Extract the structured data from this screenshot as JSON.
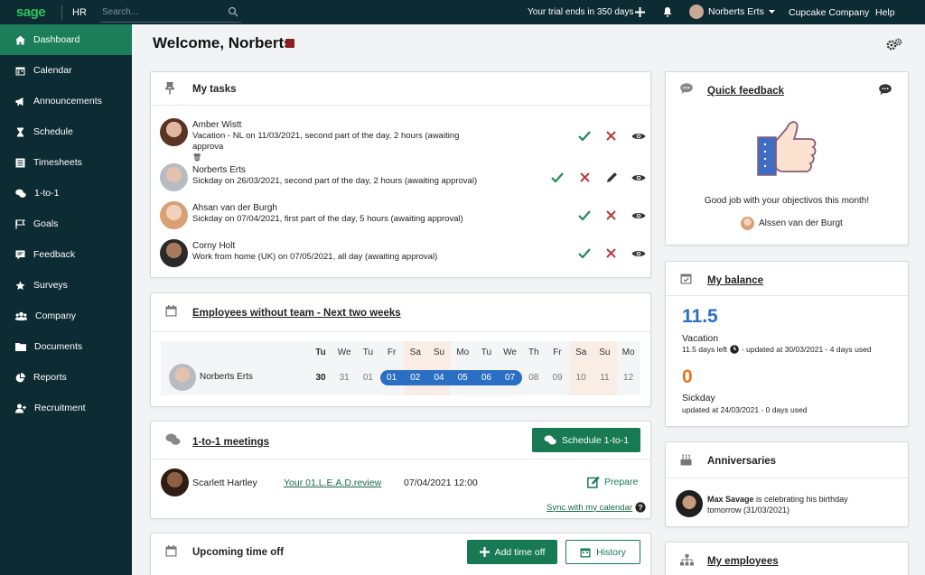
{
  "topbar": {
    "logo": "sage",
    "module": "HR",
    "search_placeholder": "Search...",
    "trial": "Your trial ends in 350 days",
    "user": "Norberts Erts",
    "company": "Cupcake Company",
    "help": "Help"
  },
  "sidebar": {
    "items": [
      {
        "label": "Dashboard",
        "icon": "home-icon",
        "active": true
      },
      {
        "label": "Calendar",
        "icon": "calendar-icon"
      },
      {
        "label": "Announcements",
        "icon": "megaphone-icon"
      },
      {
        "label": "Schedule",
        "icon": "hourglass-icon"
      },
      {
        "label": "Timesheets",
        "icon": "timesheet-icon"
      },
      {
        "label": "1-to-1",
        "icon": "chat-icon"
      },
      {
        "label": "Goals",
        "icon": "flag-icon"
      },
      {
        "label": "Feedback",
        "icon": "feedback-icon"
      },
      {
        "label": "Surveys",
        "icon": "star-icon"
      },
      {
        "label": "Company",
        "icon": "people-icon"
      },
      {
        "label": "Documents",
        "icon": "folder-icon"
      },
      {
        "label": "Reports",
        "icon": "pie-icon"
      },
      {
        "label": "Recruitment",
        "icon": "add-user-icon"
      }
    ]
  },
  "page": {
    "title": "Welcome, Norberts"
  },
  "tasks": {
    "title": "My tasks",
    "items": [
      {
        "name": "Amber Wistt",
        "desc": "Vacation - NL on 11/03/2021, second part of the day, 2 hours (awaiting approva",
        "extra": "🗑",
        "edit": false
      },
      {
        "name": "Norberts Erts",
        "desc": "Sickday on 26/03/2021, second part of the day, 2 hours (awaiting approval)",
        "edit": true
      },
      {
        "name": "Ahsan van der Burgh",
        "desc": "Sickday on 07/04/2021, first part of the day, 5 hours (awaiting approval)",
        "edit": false
      },
      {
        "name": "Corny Holt",
        "desc": "Work from home (UK) on 07/05/2021, all day (awaiting approval)",
        "edit": false
      }
    ]
  },
  "noteam": {
    "title": "Employees without team - Next two weeks",
    "employee": "Norberts Erts",
    "days": [
      "Tu",
      "We",
      "Tu",
      "Fr",
      "Sa",
      "Su",
      "Mo",
      "Tu",
      "We",
      "Th",
      "Fr",
      "Sa",
      "Su",
      "Mo"
    ],
    "dates": [
      "30",
      "31",
      "01",
      "01",
      "02",
      "04",
      "05",
      "06",
      "07",
      "08",
      "09",
      "10",
      "11",
      "12"
    ]
  },
  "meetings": {
    "title": "1-to-1 meetings",
    "schedule_btn": "Schedule 1-to-1",
    "person": "Scarlett Hartley",
    "review": "Your 01.L.E.A.D.review",
    "datetime": "07/04/2021 12:00",
    "prepare": "Prepare",
    "sync": "Sync with my calendar"
  },
  "timeoff": {
    "title": "Upcoming time off",
    "add_btn": "Add time off",
    "history_btn": "History"
  },
  "quick": {
    "title": "Quick feedback",
    "message": "Good job with your objectivos this month!",
    "from": "Alssen van der Burgt"
  },
  "balance": {
    "title": "My balance",
    "vac_value": "11.5",
    "vac_label": "Vacation",
    "vac_note_a": "11.5 days left",
    "vac_note_b": "- updated at 30/03/2021 - 4 days used",
    "sick_value": "0",
    "sick_label": "Sickday",
    "sick_note": "updated at 24/03/2021 - 0 days used"
  },
  "anniv": {
    "title": "Anniversaries",
    "name": "Max Savage",
    "text": " is celebrating his birthday",
    "when": "tomorrow (31/03/2021)"
  },
  "employees": {
    "title": "My employees"
  },
  "colors": {
    "sidebar": "#0d2b33",
    "active": "#1c7d5b",
    "green": "#177a53",
    "blue": "#2b6fc4",
    "orange": "#e07a22"
  }
}
